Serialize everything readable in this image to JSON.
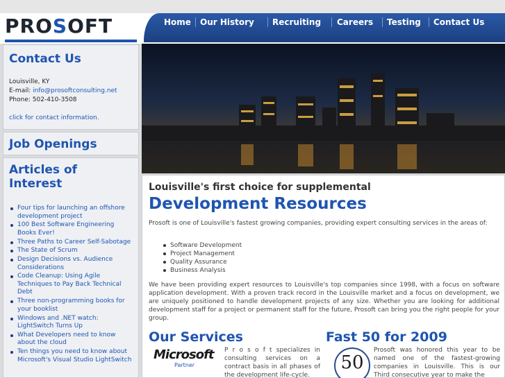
{
  "brand": {
    "logo_pre": "PRO",
    "logo_o": "S",
    "logo_post": "OFT"
  },
  "nav": [
    "Home",
    "Our History",
    "Recruiting",
    "Careers",
    "Testing",
    "Contact Us"
  ],
  "sidebar": {
    "contact": {
      "title": "Contact Us",
      "city": "Louisville, KY",
      "email_label": "E-mail:",
      "email": "info@prosoftconsulting.net",
      "phone": "Phone: 502-410-3508",
      "link": "click for contact information."
    },
    "jobs_title": "Job Openings",
    "articles_title": "Articles of Interest",
    "articles": [
      "Four tips for launching an offshore development project",
      "100 Best Software Engineering Books Ever!",
      "Three Paths to Career Self-Sabotage",
      "The State of Scrum",
      "Design Decisions vs. Audience Considerations",
      "Code Cleanup: Using Agile Techniques to Pay Back Technical Debt",
      "Three non-programming books for your booklist",
      "Windows and .NET watch: LightSwitch Turns Up",
      "What Developers need to know about the cloud",
      "Ten things you need to know about Microsoft's Visual Studio LightSwitch"
    ]
  },
  "main": {
    "subtitle": "Louisville's first choice for supplemental",
    "title": "Development Resources",
    "intro": "Prosoft is one of Louisville's fastest growing companies, providing expert consulting services in the areas of:",
    "services": [
      "Software Development",
      "Project Management",
      "Quality Assurance",
      "Business Analysis"
    ],
    "para2": "We have been providing expert resources to Louisville's top companies since 1998, with a focus on software application development. With a proven track record in the Louisville market and a focus on development, we are uniquely positioned to handle development projects of any size. Whether you are looking for additional development staff for a project or permanent staff for the future, Prosoft can bring you the right people for your group.",
    "services_heading": "Our Services",
    "ms_word": "Microsoft",
    "ms_partner": "Partner",
    "services_text": "P r o s o f t specializes in consulting services on a contract basis in all phases of the development life-cycle.",
    "fast_heading": "Fast 50 for 2009",
    "seal_number": "50",
    "fast_text": "Prosoft was honored this year to be named one of the fastest-growing companies in Louisville. This is our Third consecutive year to make the"
  }
}
